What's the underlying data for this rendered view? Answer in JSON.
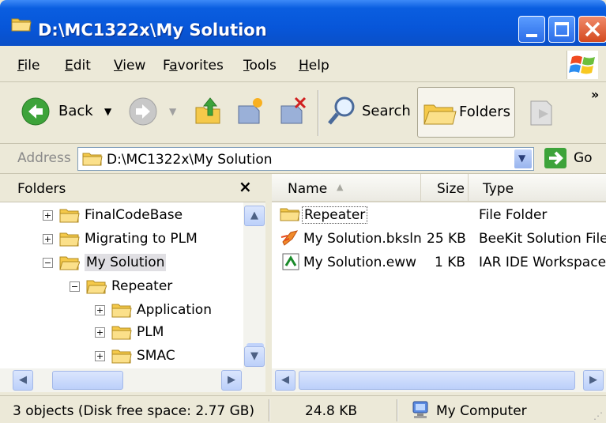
{
  "window": {
    "title": "D:\\MC1322x\\My Solution",
    "buttons": [
      "minimize",
      "maximize",
      "close"
    ]
  },
  "menu": {
    "items": [
      "File",
      "Edit",
      "View",
      "Favorites",
      "Tools",
      "Help"
    ],
    "mnemonics": [
      "F",
      "E",
      "V",
      "a",
      "T",
      "H"
    ]
  },
  "toolbar": {
    "back_label": "Back",
    "search_label": "Search",
    "folders_label": "Folders",
    "overflow": "»"
  },
  "address": {
    "label": "Address",
    "value": "D:\\MC1322x\\My Solution",
    "go_label": "Go"
  },
  "folders_pane": {
    "title": "Folders",
    "close_glyph": "×",
    "items": [
      {
        "label": "FinalCodeBase",
        "expander": "+",
        "level": 0
      },
      {
        "label": "Migrating to PLM",
        "expander": "+",
        "level": 0
      },
      {
        "label": "My Solution",
        "expander": "−",
        "level": 0,
        "selected": true
      },
      {
        "label": "Repeater",
        "expander": "−",
        "level": 1
      },
      {
        "label": "Application",
        "expander": "+",
        "level": 2
      },
      {
        "label": "PLM",
        "expander": "+",
        "level": 2
      },
      {
        "label": "SMAC",
        "expander": "+",
        "level": 2
      }
    ]
  },
  "file_list": {
    "columns": {
      "name": "Name",
      "size": "Size",
      "type": "Type"
    },
    "rows": [
      {
        "name": "Repeater",
        "size": "",
        "type": "File Folder",
        "icon": "folder-icon"
      },
      {
        "name": "My Solution.bksln",
        "size": "25 KB",
        "type": "BeeKit Solution File",
        "icon": "beekit-file-icon"
      },
      {
        "name": "My Solution.eww",
        "size": "1 KB",
        "type": "IAR IDE Workspace",
        "icon": "iar-workspace-icon"
      }
    ]
  },
  "status": {
    "objects": "3 objects (Disk free space: 2.77 GB)",
    "size": "24.8 KB",
    "zone": "My Computer"
  },
  "colors": {
    "titlebar": "#0756d9",
    "chrome": "#ece9d8",
    "folder": "#f5c94a"
  }
}
